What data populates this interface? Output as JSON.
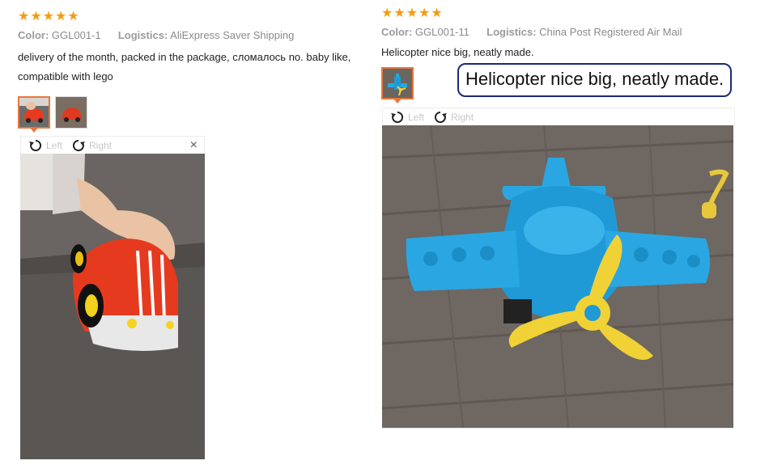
{
  "reviews": [
    {
      "stars": 5,
      "color_label": "Color:",
      "color_value": "GGL001-1",
      "logistics_label": "Logistics:",
      "logistics_value": "AliExpress Saver Shipping",
      "text_line1": "delivery of the month, packed in the package, сломалось no. baby like,",
      "text_line2": "compatible with lego",
      "toolbar": {
        "left_label": "Left",
        "right_label": "Right",
        "close_glyph": "×"
      }
    },
    {
      "stars": 5,
      "color_label": "Color:",
      "color_value": "GGL001-11",
      "logistics_label": "Logistics:",
      "logistics_value": "China Post Registered Air Mail",
      "text_line1": "Helicopter nice big, neatly made.",
      "toolbar": {
        "left_label": "Left",
        "right_label": "Right"
      },
      "tooltip": "Helicopter nice big, neatly made."
    }
  ],
  "icons": {
    "star": "star-icon",
    "rotate_left": "rotate-left-icon",
    "rotate_right": "rotate-right-icon",
    "close": "close-icon"
  },
  "colors": {
    "star": "#f39c12",
    "active_thumb": "#e8763c",
    "tooltip_border": "#1a2a7a"
  }
}
